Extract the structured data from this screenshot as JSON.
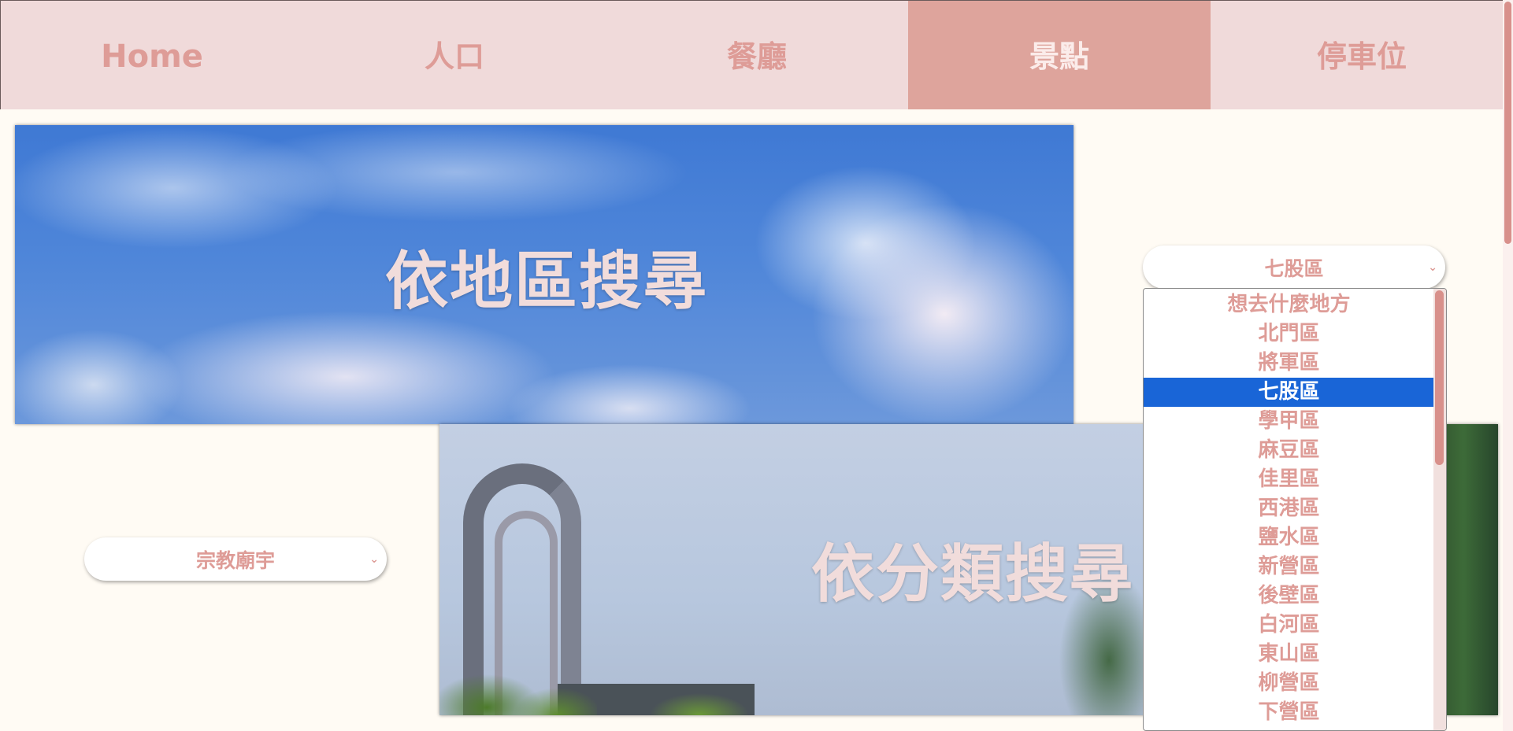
{
  "nav": {
    "items": [
      {
        "label": "Home"
      },
      {
        "label": "人口"
      },
      {
        "label": "餐廳"
      },
      {
        "label": "景點"
      },
      {
        "label": "停車位"
      }
    ],
    "active_index": 3
  },
  "banners": {
    "area_title": "依地區搜尋",
    "category_title": "依分類搜尋"
  },
  "area_select": {
    "selected": "七股區",
    "options": [
      "想去什麼地方",
      "北門區",
      "將軍區",
      "七股區",
      "學甲區",
      "麻豆區",
      "佳里區",
      "西港區",
      "鹽水區",
      "新營區",
      "後壁區",
      "白河區",
      "東山區",
      "柳營區",
      "下營區"
    ]
  },
  "category_select": {
    "selected": "宗教廟宇"
  },
  "colors": {
    "accent": "#de9c97",
    "nav_bg": "#f0dada",
    "nav_active_bg": "#dea49c",
    "page_bg": "#fffbf4",
    "selected_option_bg": "#1965d7"
  }
}
